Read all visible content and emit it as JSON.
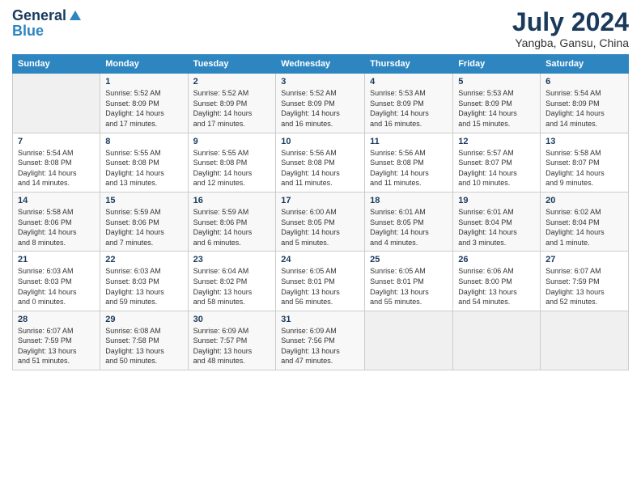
{
  "header": {
    "logo_line1": "General",
    "logo_line2": "Blue",
    "title": "July 2024",
    "subtitle": "Yangba, Gansu, China"
  },
  "columns": [
    "Sunday",
    "Monday",
    "Tuesday",
    "Wednesday",
    "Thursday",
    "Friday",
    "Saturday"
  ],
  "weeks": [
    [
      {
        "day": "",
        "info": ""
      },
      {
        "day": "1",
        "info": "Sunrise: 5:52 AM\nSunset: 8:09 PM\nDaylight: 14 hours\nand 17 minutes."
      },
      {
        "day": "2",
        "info": "Sunrise: 5:52 AM\nSunset: 8:09 PM\nDaylight: 14 hours\nand 17 minutes."
      },
      {
        "day": "3",
        "info": "Sunrise: 5:52 AM\nSunset: 8:09 PM\nDaylight: 14 hours\nand 16 minutes."
      },
      {
        "day": "4",
        "info": "Sunrise: 5:53 AM\nSunset: 8:09 PM\nDaylight: 14 hours\nand 16 minutes."
      },
      {
        "day": "5",
        "info": "Sunrise: 5:53 AM\nSunset: 8:09 PM\nDaylight: 14 hours\nand 15 minutes."
      },
      {
        "day": "6",
        "info": "Sunrise: 5:54 AM\nSunset: 8:09 PM\nDaylight: 14 hours\nand 14 minutes."
      }
    ],
    [
      {
        "day": "7",
        "info": "Sunrise: 5:54 AM\nSunset: 8:08 PM\nDaylight: 14 hours\nand 14 minutes."
      },
      {
        "day": "8",
        "info": "Sunrise: 5:55 AM\nSunset: 8:08 PM\nDaylight: 14 hours\nand 13 minutes."
      },
      {
        "day": "9",
        "info": "Sunrise: 5:55 AM\nSunset: 8:08 PM\nDaylight: 14 hours\nand 12 minutes."
      },
      {
        "day": "10",
        "info": "Sunrise: 5:56 AM\nSunset: 8:08 PM\nDaylight: 14 hours\nand 11 minutes."
      },
      {
        "day": "11",
        "info": "Sunrise: 5:56 AM\nSunset: 8:08 PM\nDaylight: 14 hours\nand 11 minutes."
      },
      {
        "day": "12",
        "info": "Sunrise: 5:57 AM\nSunset: 8:07 PM\nDaylight: 14 hours\nand 10 minutes."
      },
      {
        "day": "13",
        "info": "Sunrise: 5:58 AM\nSunset: 8:07 PM\nDaylight: 14 hours\nand 9 minutes."
      }
    ],
    [
      {
        "day": "14",
        "info": "Sunrise: 5:58 AM\nSunset: 8:06 PM\nDaylight: 14 hours\nand 8 minutes."
      },
      {
        "day": "15",
        "info": "Sunrise: 5:59 AM\nSunset: 8:06 PM\nDaylight: 14 hours\nand 7 minutes."
      },
      {
        "day": "16",
        "info": "Sunrise: 5:59 AM\nSunset: 8:06 PM\nDaylight: 14 hours\nand 6 minutes."
      },
      {
        "day": "17",
        "info": "Sunrise: 6:00 AM\nSunset: 8:05 PM\nDaylight: 14 hours\nand 5 minutes."
      },
      {
        "day": "18",
        "info": "Sunrise: 6:01 AM\nSunset: 8:05 PM\nDaylight: 14 hours\nand 4 minutes."
      },
      {
        "day": "19",
        "info": "Sunrise: 6:01 AM\nSunset: 8:04 PM\nDaylight: 14 hours\nand 3 minutes."
      },
      {
        "day": "20",
        "info": "Sunrise: 6:02 AM\nSunset: 8:04 PM\nDaylight: 14 hours\nand 1 minute."
      }
    ],
    [
      {
        "day": "21",
        "info": "Sunrise: 6:03 AM\nSunset: 8:03 PM\nDaylight: 14 hours\nand 0 minutes."
      },
      {
        "day": "22",
        "info": "Sunrise: 6:03 AM\nSunset: 8:03 PM\nDaylight: 13 hours\nand 59 minutes."
      },
      {
        "day": "23",
        "info": "Sunrise: 6:04 AM\nSunset: 8:02 PM\nDaylight: 13 hours\nand 58 minutes."
      },
      {
        "day": "24",
        "info": "Sunrise: 6:05 AM\nSunset: 8:01 PM\nDaylight: 13 hours\nand 56 minutes."
      },
      {
        "day": "25",
        "info": "Sunrise: 6:05 AM\nSunset: 8:01 PM\nDaylight: 13 hours\nand 55 minutes."
      },
      {
        "day": "26",
        "info": "Sunrise: 6:06 AM\nSunset: 8:00 PM\nDaylight: 13 hours\nand 54 minutes."
      },
      {
        "day": "27",
        "info": "Sunrise: 6:07 AM\nSunset: 7:59 PM\nDaylight: 13 hours\nand 52 minutes."
      }
    ],
    [
      {
        "day": "28",
        "info": "Sunrise: 6:07 AM\nSunset: 7:59 PM\nDaylight: 13 hours\nand 51 minutes."
      },
      {
        "day": "29",
        "info": "Sunrise: 6:08 AM\nSunset: 7:58 PM\nDaylight: 13 hours\nand 50 minutes."
      },
      {
        "day": "30",
        "info": "Sunrise: 6:09 AM\nSunset: 7:57 PM\nDaylight: 13 hours\nand 48 minutes."
      },
      {
        "day": "31",
        "info": "Sunrise: 6:09 AM\nSunset: 7:56 PM\nDaylight: 13 hours\nand 47 minutes."
      },
      {
        "day": "",
        "info": ""
      },
      {
        "day": "",
        "info": ""
      },
      {
        "day": "",
        "info": ""
      }
    ]
  ]
}
